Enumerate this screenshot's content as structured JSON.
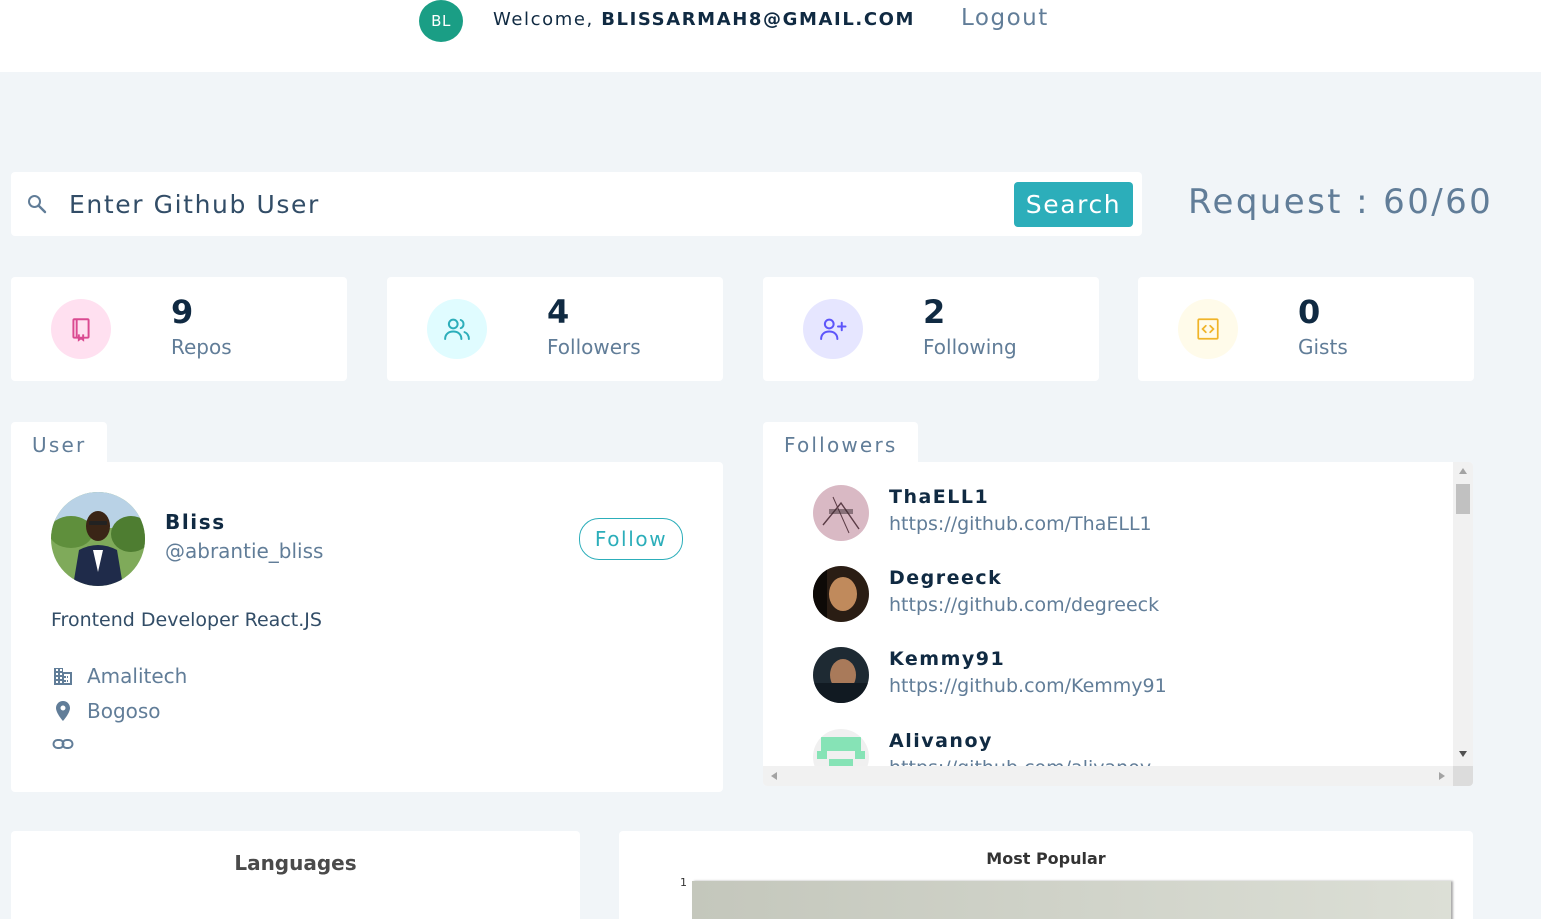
{
  "header": {
    "avatar_initials": "BL",
    "welcome_prefix": "Welcome, ",
    "user_email": "BLISSARMAH8@GMAIL.COM",
    "logout_label": "Logout"
  },
  "search": {
    "placeholder": "Enter Github User",
    "button_label": "Search",
    "request_text": "Request : 60/60"
  },
  "stats": [
    {
      "value": "9",
      "label": "Repos",
      "icon": "book-icon",
      "color": "#da4a91",
      "bg": "#ffe0f0"
    },
    {
      "value": "4",
      "label": "Followers",
      "icon": "users-icon",
      "color": "#2caeba",
      "bg": "#e0fcff"
    },
    {
      "value": "2",
      "label": "Following",
      "icon": "user-plus-icon",
      "color": "#5d55fa",
      "bg": "#e6e6ff"
    },
    {
      "value": "0",
      "label": "Gists",
      "icon": "code-icon",
      "color": "#f0b429",
      "bg": "#fffbea"
    }
  ],
  "user_card": {
    "tab_label": "User",
    "name": "Bliss",
    "handle": "@abrantie_bliss",
    "follow_label": "Follow",
    "bio": "Frontend Developer React.JS",
    "company": "Amalitech",
    "location": "Bogoso",
    "blog": ""
  },
  "followers_card": {
    "tab_label": "Followers",
    "items": [
      {
        "login": "ThaELL1",
        "url": "https://github.com/ThaELL1"
      },
      {
        "login": "Degreeck",
        "url": "https://github.com/degreeck"
      },
      {
        "login": "Kemmy91",
        "url": "https://github.com/Kemmy91"
      },
      {
        "login": "Alivanoy",
        "url": "https://github.com/alivanoy"
      }
    ]
  },
  "charts": {
    "languages_title": "Languages",
    "popular_title": "Most Popular",
    "popular_axis_tick": "1"
  },
  "colors": {
    "accent": "#2caeba",
    "avatar_bg": "#1a9e85"
  }
}
